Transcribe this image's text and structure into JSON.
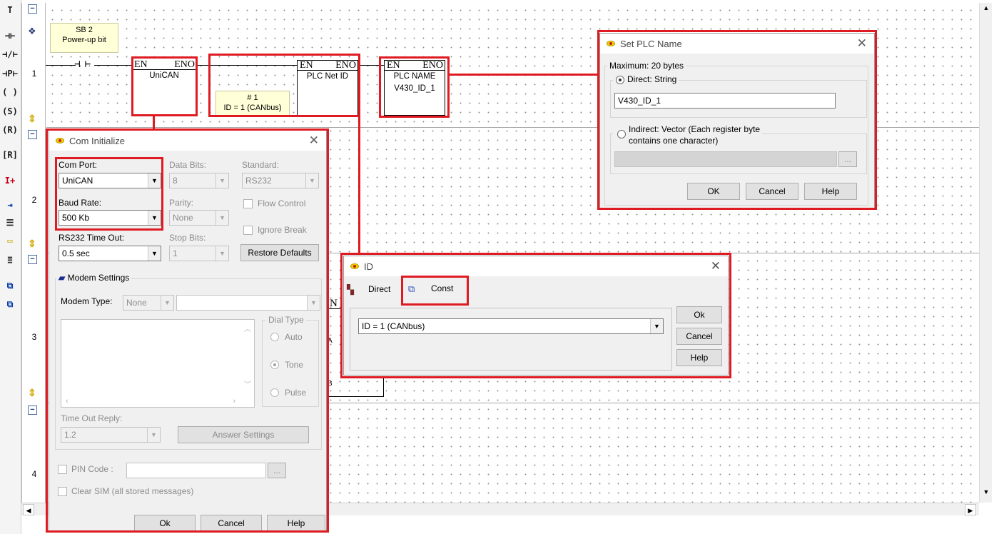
{
  "toolbar": {
    "tools": [
      {
        "icon": "wire-tool-icon",
        "glyph": "T"
      },
      {
        "icon": "contact-no-icon",
        "glyph": "⊣⊢"
      },
      {
        "icon": "contact-nc-icon",
        "glyph": "⊣/⊢"
      },
      {
        "icon": "contact-p-icon",
        "glyph": "⊣P⊢"
      },
      {
        "icon": "coil-icon",
        "glyph": "( )"
      },
      {
        "icon": "set-coil-icon",
        "glyph": "(S)"
      },
      {
        "icon": "reset-coil-icon",
        "glyph": "(R)"
      },
      {
        "icon": "reset-block-icon",
        "glyph": "[R]"
      },
      {
        "icon": "increment-icon",
        "glyph": "I+"
      },
      {
        "icon": "store-icon",
        "glyph": "⇥"
      },
      {
        "icon": "compare-icon",
        "glyph": "☰"
      },
      {
        "icon": "comment-icon",
        "glyph": "▭"
      },
      {
        "icon": "list-icon",
        "glyph": "≣"
      },
      {
        "icon": "copy-icon",
        "glyph": "⧉"
      },
      {
        "icon": "multi-copy-icon",
        "glyph": "⧉"
      }
    ]
  },
  "ladder": {
    "rungs": [
      "1",
      "2",
      "3",
      "4"
    ],
    "sb2_note": {
      "line1": "SB 2",
      "line2": "Power-up bit"
    },
    "id_note": {
      "line1": "# 1",
      "line2": "ID = 1 (CANbus)"
    },
    "blocks": {
      "unican": {
        "en": "EN",
        "eno": "ENO",
        "title": "UniCAN"
      },
      "netid": {
        "en": "EN",
        "eno": "ENO",
        "title": "PLC Net ID"
      },
      "plcname": {
        "en": "EN",
        "eno": "ENO",
        "title": "PLC NAME",
        "sub": "V430_ID_1"
      }
    },
    "hidden_block_fragments": {
      "n": "N",
      "a": "A",
      "b": "B"
    }
  },
  "com_init": {
    "title": "Com Initialize",
    "com_port": {
      "label": "Com Port:",
      "value": "UniCAN"
    },
    "data_bits": {
      "label": "Data Bits:",
      "value": "8"
    },
    "standard": {
      "label": "Standard:",
      "value": "RS232"
    },
    "baud_rate": {
      "label": "Baud Rate:",
      "value": "500 Kb"
    },
    "parity": {
      "label": "Parity:",
      "value": "None"
    },
    "flow_control": "Flow Control",
    "rs232_timeout": {
      "label": "RS232 Time Out:",
      "value": "0.5 sec"
    },
    "stop_bits": {
      "label": "Stop Bits:",
      "value": "1"
    },
    "ignore_break": "Ignore Break",
    "restore_defaults": "Restore Defaults",
    "modem_settings": "Modem Settings",
    "modem_type": {
      "label": "Modem Type:",
      "value": "None",
      "value2": ""
    },
    "dial_type": {
      "label": "Dial Type",
      "auto": "Auto",
      "tone": "Tone",
      "pulse": "Pulse"
    },
    "timeout_reply": {
      "label": "Time Out Reply:",
      "value": "1.2"
    },
    "answer_settings": "Answer Settings",
    "pin_code": {
      "label": "PIN Code :",
      "value": "",
      "browse": "..."
    },
    "clear_sim": "Clear SIM (all stored messages)",
    "ok": "Ok",
    "cancel": "Cancel",
    "help": "Help"
  },
  "set_plc_name": {
    "title": "Set PLC Name",
    "max_group": "Maximum: 20 bytes",
    "direct": {
      "label": "Direct: String",
      "value": "V430_ID_1"
    },
    "indirect": {
      "line1": "Indirect: Vector (Each register byte",
      "line2": "contains one character)",
      "browse": "..."
    },
    "ok": "OK",
    "cancel": "Cancel",
    "help": "Help"
  },
  "id_dialog": {
    "title": "ID",
    "tab_direct": "Direct",
    "tab_const": "Const",
    "value": "ID = 1 (CANbus)",
    "ok": "Ok",
    "cancel": "Cancel",
    "help": "Help"
  },
  "colors": {
    "highlight": "#de1b22",
    "note": "#ffffd8",
    "dialog": "#f0f0f0"
  }
}
